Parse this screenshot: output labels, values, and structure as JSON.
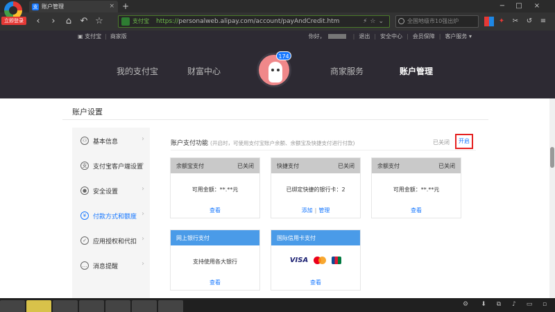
{
  "browser": {
    "login_badge": "立即登录",
    "tab_title": "账户管理",
    "tab_icon_glyph": "支",
    "new_tab": "+",
    "url_site_label": "支付宝",
    "url_scheme": "https://",
    "url_rest": "personalweb.alipay.com/account/payAndCredit.htm",
    "search_placeholder": "全国地级市10强出炉",
    "window_controls": [
      "−",
      "□",
      "×"
    ]
  },
  "alipay_top": {
    "brand": "支付宝",
    "merchant": "商家版",
    "greeting": "你好，",
    "logout": "退出",
    "security_center": "安全中心",
    "member_protect": "会员保障",
    "customer_service": "客户服务 ▾"
  },
  "alipay_nav": {
    "items": [
      "我的支付宝",
      "财富中心",
      "商家服务",
      "账户管理"
    ],
    "badge_count": "174"
  },
  "page": {
    "title": "账户设置"
  },
  "sidebar": {
    "items": [
      {
        "label": "基本信息",
        "icon": "user-icon"
      },
      {
        "label": "支付宝客户端设置",
        "icon": "app-icon"
      },
      {
        "label": "安全设置",
        "icon": "lock-icon"
      },
      {
        "label": "付款方式和额度",
        "icon": "wallet-icon"
      },
      {
        "label": "应用授权和代扣",
        "icon": "authorize-icon"
      },
      {
        "label": "消息提醒",
        "icon": "message-icon"
      }
    ],
    "active_index": 3
  },
  "feature": {
    "name": "账户支付功能",
    "desc": "(开启时，可使用支付宝账户余额、余额宝及快捷支付进行付款)",
    "status": "已关闭",
    "open_button": "开启"
  },
  "cards": [
    {
      "title": "余额宝支付",
      "state": "已关闭",
      "body": "可用金额：**.**元",
      "links": [
        "查看"
      ]
    },
    {
      "title": "快捷支付",
      "state": "已关闭",
      "body": "已绑定快捷的银行卡：2",
      "links": [
        "添加",
        "管理"
      ]
    },
    {
      "title": "余额支付",
      "state": "已关闭",
      "body": "可用金额：**.**元",
      "links": [
        "查看"
      ]
    },
    {
      "title": "网上银行支付",
      "state": "",
      "body": "支持使用各大银行",
      "links": [
        "查看"
      ]
    },
    {
      "title": "国际信用卡支付",
      "state": "",
      "body": "",
      "links": [
        "查看"
      ],
      "logos": [
        "VISA",
        "mastercard",
        "JCB"
      ]
    }
  ]
}
